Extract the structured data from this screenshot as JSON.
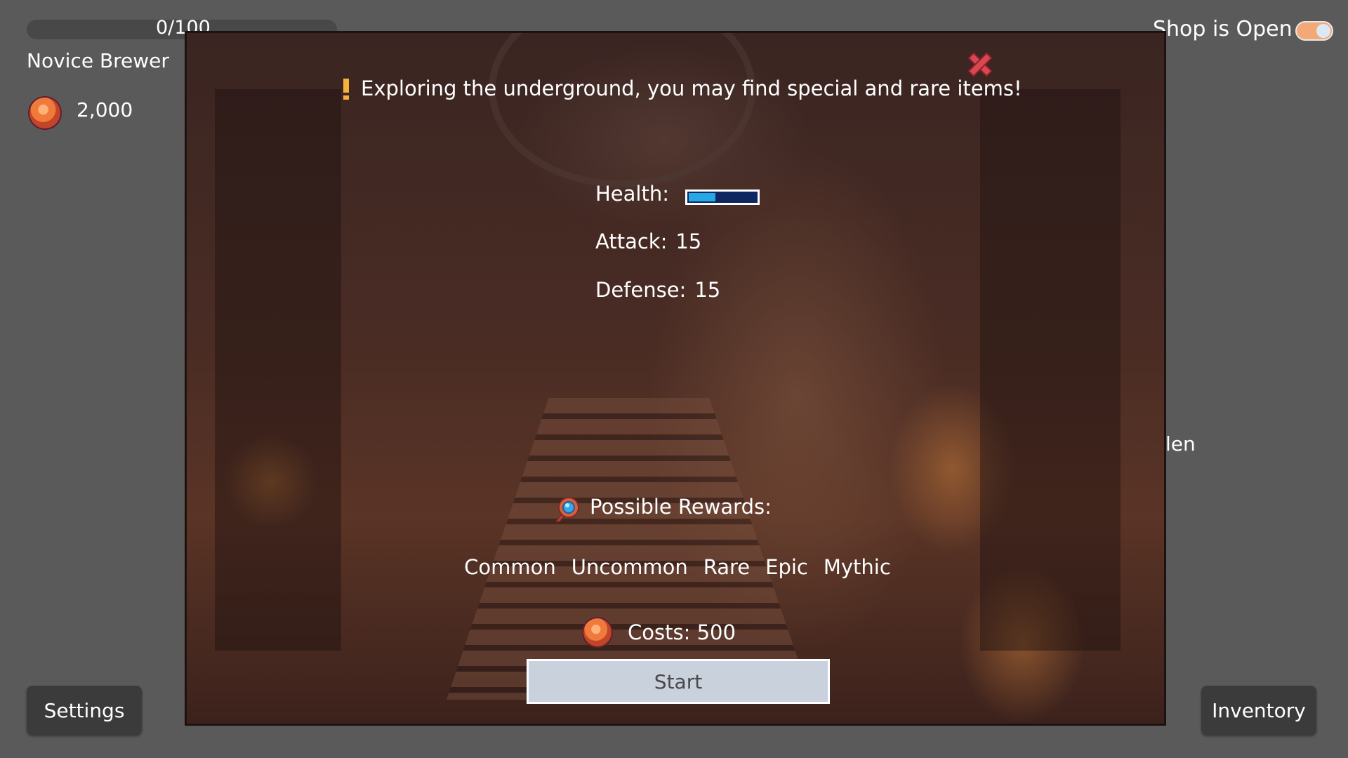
{
  "hud": {
    "xp_text": "0/100",
    "xp_progress": 0,
    "rank": "Novice Brewer",
    "coins": "2,000",
    "shop_status": "Shop is Open",
    "shop_toggle_on": true,
    "side_text_fragment": "len"
  },
  "buttons": {
    "settings": "Settings",
    "inventory": "Inventory"
  },
  "modal": {
    "hint": "Exploring the underground, you may find special and rare items!",
    "stats": {
      "health_label": "Health:",
      "health_fraction": 0.4,
      "attack_label": "Attack:",
      "attack_value": "15",
      "defense_label": "Defense:",
      "defense_value": "15"
    },
    "rewards_title": "Possible Rewards:",
    "rarities": [
      "Common",
      "Uncommon",
      "Rare",
      "Epic",
      "Mythic"
    ],
    "cost_text": "Costs: 500",
    "start_label": "Start"
  },
  "icons": {
    "coin": "coin-icon",
    "close": "close-icon",
    "hint": "exclamation-icon",
    "reward": "gem-bag-icon"
  },
  "colors": {
    "background": "#5a5a5a",
    "button_dark": "#3b3b3b",
    "close_red": "#d9484e",
    "health_fill": "#27a8e6",
    "health_track": "#0f2760",
    "toggle_on": "#f3a877",
    "hint_accent": "#f5b23a"
  }
}
